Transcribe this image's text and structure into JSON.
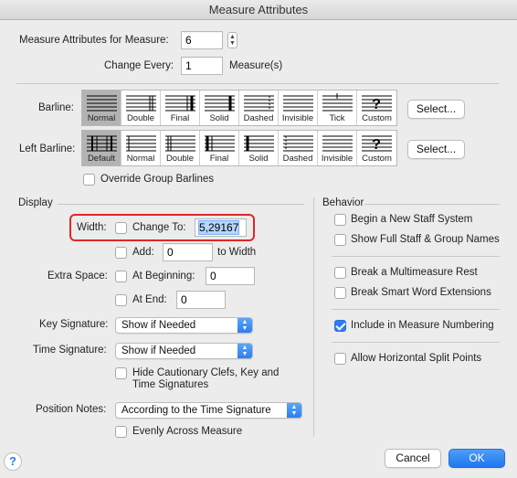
{
  "window": {
    "title": "Measure Attributes"
  },
  "measure_attributes": {
    "label": "Measure Attributes for Measure:",
    "value": "6",
    "change_every_label": "Change Every:",
    "change_every_value": "1",
    "unit": "Measure(s)"
  },
  "barline": {
    "label": "Barline:",
    "options": [
      "Normal",
      "Double",
      "Final",
      "Solid",
      "Dashed",
      "Invisible",
      "Tick",
      "Custom"
    ],
    "selected": "Normal",
    "select_label": "Select..."
  },
  "left_barline": {
    "label": "Left Barline:",
    "options": [
      "Default",
      "Normal",
      "Double",
      "Final",
      "Solid",
      "Dashed",
      "Invisible",
      "Custom"
    ],
    "selected": "Default",
    "select_label": "Select..."
  },
  "override_group_barlines": {
    "label": "Override Group Barlines",
    "checked": false
  },
  "display": {
    "heading": "Display",
    "width_label": "Width:",
    "change_to_label": "Change To:",
    "change_to_value": "5,29167",
    "add_label": "Add:",
    "add_value": "0",
    "to_width_label": "to Width",
    "extra_space_label": "Extra Space:",
    "at_beginning_label": "At Beginning:",
    "at_beginning_value": "0",
    "at_end_label": "At End:",
    "at_end_value": "0",
    "key_signature_label": "Key Signature:",
    "key_signature_value": "Show if Needed",
    "time_signature_label": "Time Signature:",
    "time_signature_value": "Show if Needed",
    "hide_cautionary_line1": "Hide Cautionary Clefs, Key and",
    "hide_cautionary_line2": "Time Signatures",
    "position_notes_label": "Position Notes:",
    "position_notes_value": "According to the Time Signature",
    "evenly_label": "Evenly Across Measure"
  },
  "behavior": {
    "heading": "Behavior",
    "items": [
      {
        "label": "Begin a New Staff System",
        "checked": false
      },
      {
        "label": "Show Full Staff & Group Names",
        "checked": false
      },
      {
        "label": "Break a Multimeasure Rest",
        "checked": false
      },
      {
        "label": "Break Smart Word Extensions",
        "checked": false
      },
      {
        "label": "Include in Measure Numbering",
        "checked": true
      },
      {
        "label": "Allow Horizontal Split Points",
        "checked": false
      }
    ]
  },
  "footer": {
    "help": "?",
    "cancel": "Cancel",
    "ok": "OK"
  },
  "colors": {
    "accent": "#2e7cf6",
    "highlight": "#e0262a"
  }
}
